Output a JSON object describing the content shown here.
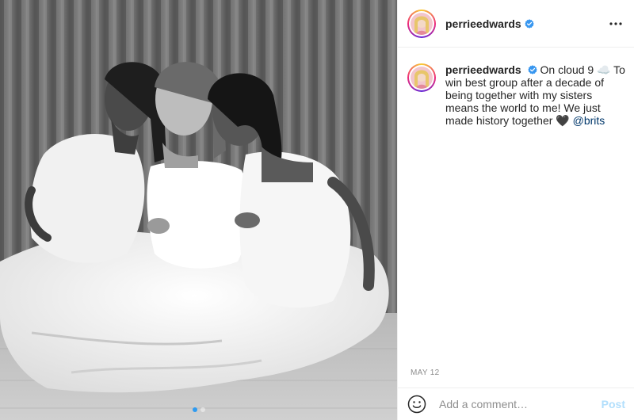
{
  "post": {
    "username": "perrieedwards",
    "verified": true,
    "caption": {
      "username": "perrieedwards",
      "text": " On cloud 9 ☁️ To win best group after a decade of being together with my sisters means the world to me! We just made history together 🖤 ",
      "mention": "@brits"
    },
    "date": "MAY 12",
    "carousel": {
      "count": 2,
      "active_index": 0
    }
  },
  "comment": {
    "placeholder": "Add a comment…",
    "post_label": "Post"
  },
  "icons": {
    "more": "more-horizontal-icon",
    "verified": "verified-badge-icon",
    "emoji": "emoji-smiley-icon"
  },
  "colors": {
    "verified_blue": "#3897f0",
    "mention": "#00376b",
    "post_button_disabled": "#b2dffc",
    "secondary_text": "#8e8e8e"
  }
}
